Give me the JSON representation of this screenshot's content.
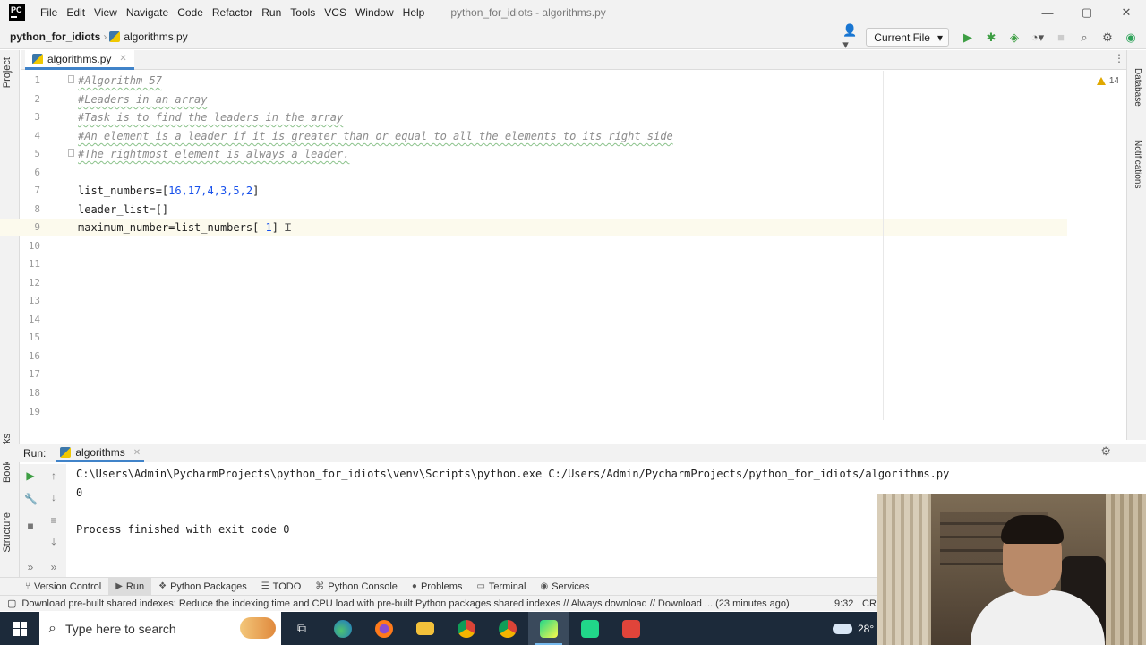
{
  "titlebar": {
    "logo": "PC",
    "menu": [
      "File",
      "Edit",
      "View",
      "Navigate",
      "Code",
      "Refactor",
      "Run",
      "Tools",
      "VCS",
      "Window",
      "Help"
    ],
    "window_title": "python_for_idiots - algorithms.py",
    "minimize": "—",
    "maximize": "▢",
    "close": "✕"
  },
  "navbar": {
    "project": "python_for_idiots",
    "file": "algorithms.py",
    "run_config": "Current File"
  },
  "left_strip": {
    "project_tab": "Project",
    "bookmarks_tab": "Bookmarks",
    "structure_tab": "Structure"
  },
  "right_strip": {
    "database_tab": "Database",
    "notifications_tab": "Notifications"
  },
  "editor": {
    "tab_label": "algorithms.py",
    "inspection_count": "14",
    "line_numbers": [
      "1",
      "2",
      "3",
      "4",
      "5",
      "6",
      "7",
      "8",
      "9",
      "10",
      "11",
      "12",
      "13",
      "14",
      "15",
      "16",
      "17",
      "18",
      "19"
    ],
    "lines": {
      "l1": "#Algorithm 57",
      "l2": "#Leaders in an array",
      "l3": "#Task is to find the leaders in the array",
      "l4": "#An element is a leader if it is greater than or equal to all the elements to its right side",
      "l5": "#The rightmost element is always a leader.",
      "l7_name": "list_numbers=[",
      "l7_values": "16,17,4,3,5,2",
      "l7_close": "]",
      "l8": "leader_list=[]",
      "l9_name": "maximum_number=list_numbers[",
      "l9_index": "-1",
      "l9_close": "]"
    }
  },
  "run_panel": {
    "label": "Run:",
    "tab": "algorithms",
    "console": [
      "C:\\Users\\Admin\\PycharmProjects\\python_for_idiots\\venv\\Scripts\\python.exe C:/Users/Admin/PycharmProjects/python_for_idiots/algorithms.py",
      "0",
      "",
      "Process finished with exit code 0"
    ]
  },
  "bottom_tabs": [
    {
      "label": "Version Control",
      "icon": "branch-icon"
    },
    {
      "label": "Run",
      "icon": "run-icon"
    },
    {
      "label": "Python Packages",
      "icon": "packages-icon"
    },
    {
      "label": "TODO",
      "icon": "list-icon"
    },
    {
      "label": "Python Console",
      "icon": "console-icon"
    },
    {
      "label": "Problems",
      "icon": "problems-icon"
    },
    {
      "label": "Terminal",
      "icon": "terminal-icon"
    },
    {
      "label": "Services",
      "icon": "services-icon"
    }
  ],
  "statusbar": {
    "message": "Download pre-built shared indexes: Reduce the indexing time and CPU load with pre-built Python packages shared indexes // Always download // Download ... (23 minutes ago)",
    "position": "9:32",
    "encoding": "CRL"
  },
  "taskbar": {
    "search_placeholder": "Type here to search",
    "weather": "28°"
  },
  "colors": {
    "accent": "#4083c9",
    "comment": "#8c8c8c",
    "number": "#1750eb",
    "run_green": "#3d9e43",
    "taskbar": "#1c2a3a"
  }
}
